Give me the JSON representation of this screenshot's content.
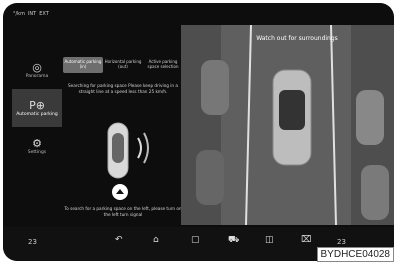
{
  "topbar": {
    "left_items": [
      "°/km",
      "INT",
      "EXT"
    ],
    "signal": "signal"
  },
  "sidebar": {
    "items": [
      {
        "label": "Panorama",
        "icon": "camera-icon",
        "active": false
      },
      {
        "label": "Automatic parking",
        "icon": "parking-icon",
        "active": true
      },
      {
        "label": "Settings",
        "icon": "gear-icon",
        "active": false
      }
    ]
  },
  "tabs": [
    {
      "label": "Automatic parking (in)",
      "active": true
    },
    {
      "label": "Horizontal parking (out)",
      "active": false
    },
    {
      "label": "Active parking space selection",
      "active": false
    }
  ],
  "main": {
    "status": "Searching for parking space\nPlease keep driving in a straight line at a speed less than 25 km/h.",
    "instruction": "To search for a parking space on the left, please turn on the left turn signal"
  },
  "camera": {
    "warning": "Watch out for surroundings"
  },
  "bottombar": {
    "left_temp": "23",
    "right_temp": "23"
  },
  "figure_label": "BYDHCE04028"
}
